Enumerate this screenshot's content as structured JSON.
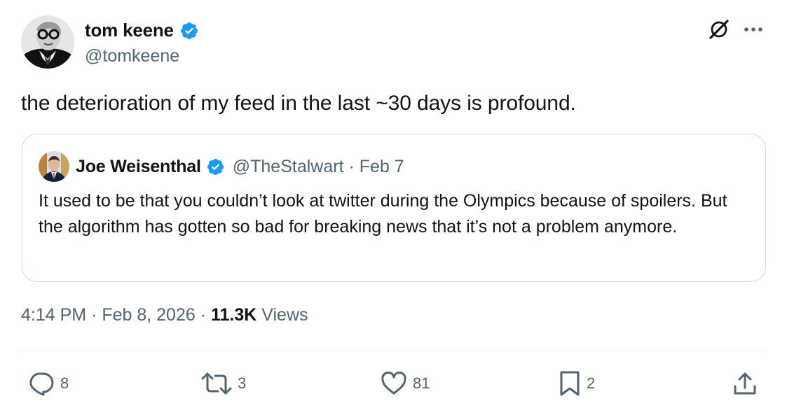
{
  "author": {
    "name": "tom keene",
    "handle": "@tomkeene",
    "verified": true
  },
  "tweet": {
    "text": "the deterioration of my feed in the last ~30 days is profound."
  },
  "quoted_tweet": {
    "name": "Joe Weisenthal",
    "verified": true,
    "handle_date": "@TheStalwart · Feb 7",
    "text": "It used to be that you couldn’t look at twitter during the Olympics because of spoilers. But the algorithm has gotten so bad for breaking news that it’s not a problem anymore."
  },
  "meta": {
    "timestamp": "4:14 PM · Feb 8, 2026 · ",
    "views_count": "11.3K",
    "views_label": " Views"
  },
  "actions": {
    "replies": "8",
    "reposts": "3",
    "likes": "81",
    "bookmarks": "2"
  },
  "colors": {
    "verified": "#1d9bf0",
    "secondary_text": "#536471",
    "border": "#cfd9de"
  },
  "icons": {
    "grok": "grok-icon",
    "more": "more-dots-icon",
    "reply": "reply-icon",
    "repost": "repost-icon",
    "like": "heart-icon",
    "bookmark": "bookmark-icon",
    "share": "share-icon"
  }
}
